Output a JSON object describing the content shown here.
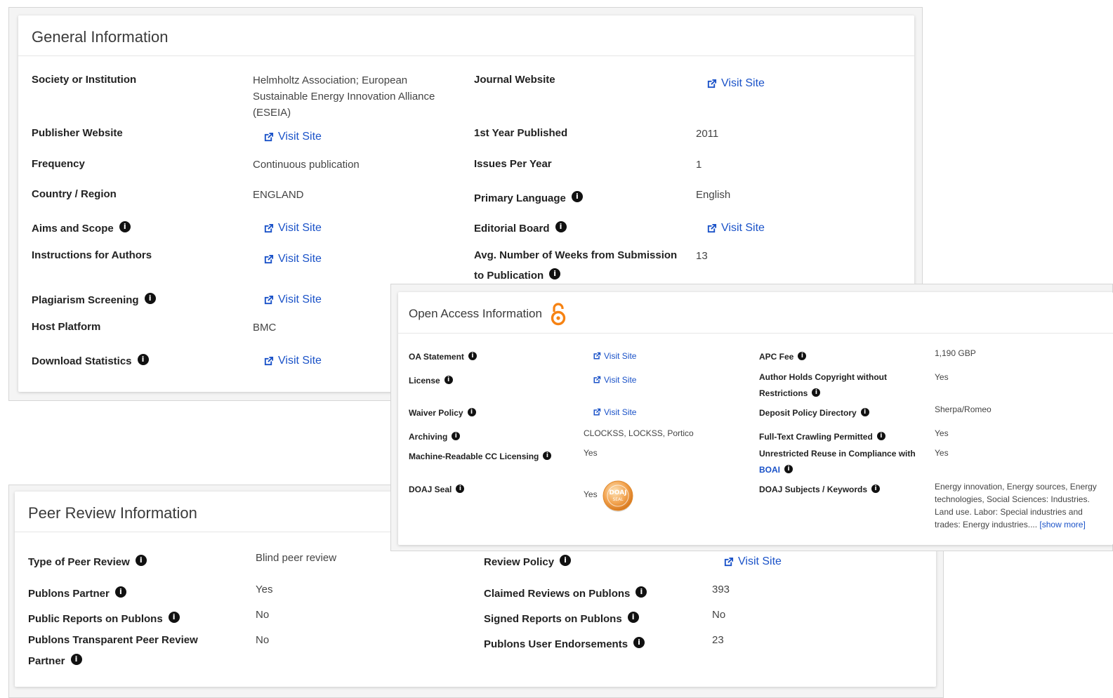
{
  "general": {
    "title": "General Information",
    "society_label": "Society or Institution",
    "society_value": "Helmholtz Association; European Sustainable Energy Innovation Alliance (ESEIA)",
    "journal_website_label": "Journal Website",
    "publisher_website_label": "Publisher Website",
    "first_year_label": "1st Year Published",
    "first_year_value": "2011",
    "frequency_label": "Frequency",
    "frequency_value": "Continuous publication",
    "issues_label": "Issues Per Year",
    "issues_value": "1",
    "country_label": "Country / Region",
    "country_value": "ENGLAND",
    "language_label": "Primary Language",
    "language_value": "English",
    "aims_label": "Aims and Scope",
    "editorial_label": "Editorial Board",
    "instructions_label": "Instructions for Authors",
    "weeks_label_line1": "Avg. Number of Weeks from Submission",
    "weeks_label_line2": "to Publication",
    "weeks_value": "13",
    "plagiarism_label": "Plagiarism Screening",
    "host_label": "Host Platform",
    "host_value": "BMC",
    "download_label": "Download Statistics",
    "visit_site": "Visit Site"
  },
  "open_access": {
    "title": "Open Access Information",
    "oa_statement_label": "OA Statement",
    "license_label": "License",
    "waiver_label": "Waiver Policy",
    "archiving_label": "Archiving",
    "archiving_value": "CLOCKSS, LOCKSS, Portico",
    "mr_cc_label": "Machine-Readable CC Licensing",
    "mr_cc_value": "Yes",
    "doaj_seal_label": "DOAJ Seal",
    "doaj_seal_value": "Yes",
    "doaj_badge_text": "DOAJ SEAL",
    "apc_label": "APC Fee",
    "apc_value": "1,190 GBP",
    "copyright_label_line1": "Author Holds Copyright without",
    "copyright_label_line2": "Restrictions",
    "copyright_value": "Yes",
    "deposit_label": "Deposit Policy Directory",
    "deposit_value": "Sherpa/Romeo",
    "crawling_label": "Full-Text Crawling Permitted",
    "crawling_value": "Yes",
    "reuse_label_line1": "Unrestricted Reuse in Compliance with",
    "reuse_label_boai": "BOAI",
    "reuse_value": "Yes",
    "subjects_label": "DOAJ Subjects / Keywords",
    "subjects_value": "Energy innovation, Energy sources, Energy technologies, Social Sciences: Industries. Land use. Labor: Special industries and trades: Energy industries....",
    "show_more": "[show more]",
    "visit_site": "Visit Site"
  },
  "peer_review": {
    "title": "Peer Review Information",
    "type_label": "Type of Peer Review",
    "type_value": "Blind peer review",
    "review_policy_label": "Review Policy",
    "publons_partner_label": "Publons Partner",
    "publons_partner_value": "Yes",
    "claimed_label": "Claimed Reviews on Publons",
    "claimed_value": "393",
    "public_reports_label": "Public Reports on Publons",
    "public_reports_value": "No",
    "signed_label": "Signed Reports on Publons",
    "signed_value": "No",
    "transparent_label_line1": "Publons Transparent Peer Review",
    "transparent_label_line2": "Partner",
    "transparent_value": "No",
    "endorsements_label": "Publons User Endorsements",
    "endorsements_value": "23",
    "visit_site": "Visit Site"
  },
  "colors": {
    "link": "#1a52c8",
    "oa_icon": "#f68212",
    "info_icon": "#111111"
  },
  "icons": [
    "external-link-icon",
    "info-icon",
    "open-access-lock-icon",
    "doaj-seal-icon"
  ]
}
